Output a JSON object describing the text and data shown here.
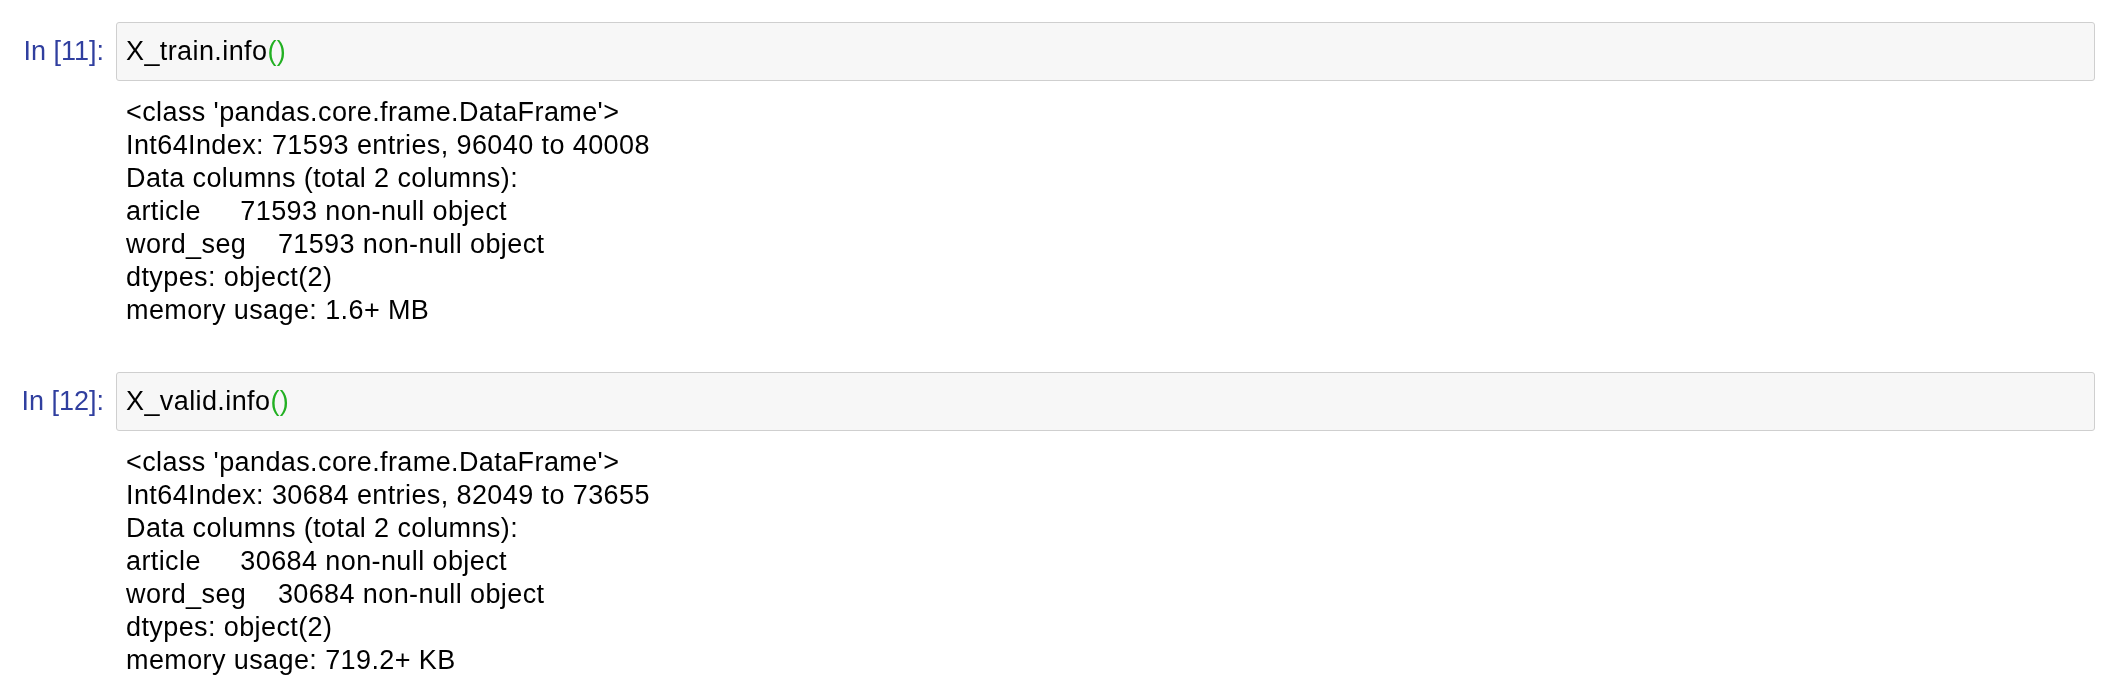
{
  "cells": [
    {
      "prompt": "In [11]:",
      "code": [
        {
          "text": "X_train.info",
          "kind": "plain"
        },
        {
          "text": "()",
          "kind": "bracket"
        }
      ],
      "output": [
        "<class 'pandas.core.frame.DataFrame'>",
        "Int64Index: 71593 entries, 96040 to 40008",
        "Data columns (total 2 columns):",
        "article     71593 non-null object",
        "word_seg    71593 non-null object",
        "dtypes: object(2)",
        "memory usage: 1.6+ MB"
      ]
    },
    {
      "prompt": "In [12]:",
      "code": [
        {
          "text": "X_valid.info",
          "kind": "plain"
        },
        {
          "text": "()",
          "kind": "bracket"
        }
      ],
      "output": [
        "<class 'pandas.core.frame.DataFrame'>",
        "Int64Index: 30684 entries, 82049 to 73655",
        "Data columns (total 2 columns):",
        "article     30684 non-null object",
        "word_seg    30684 non-null object",
        "dtypes: object(2)",
        "memory usage: 719.2+ KB"
      ]
    }
  ]
}
